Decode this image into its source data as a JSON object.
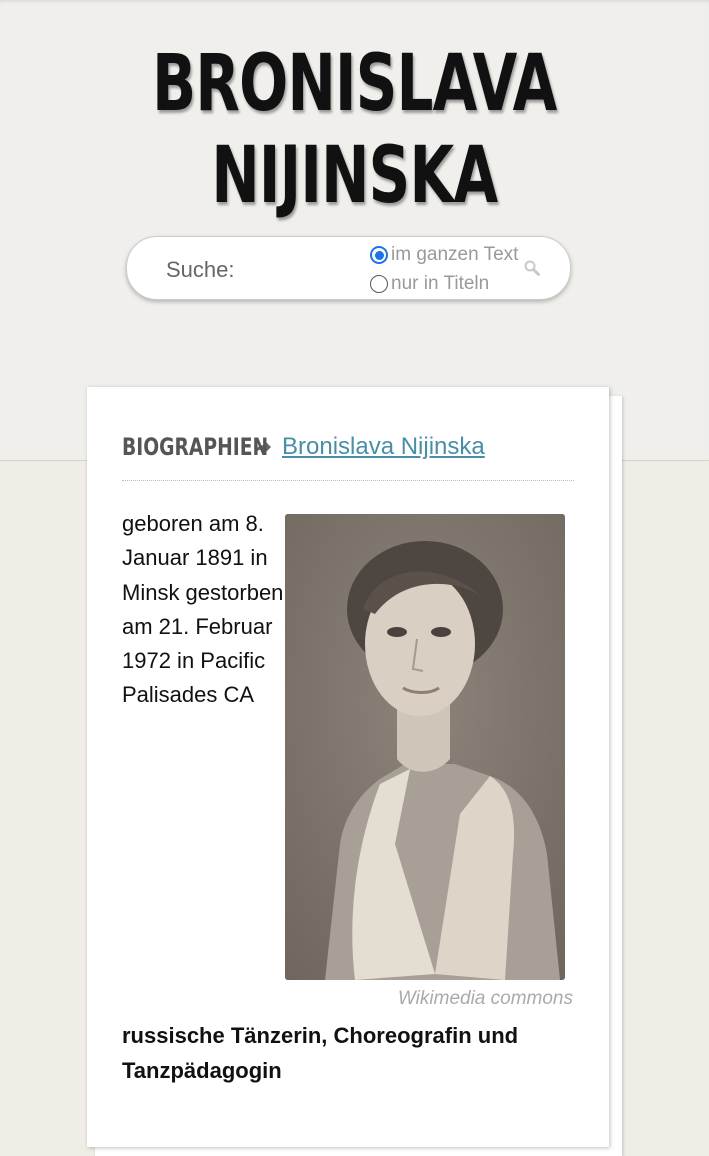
{
  "site": {
    "title_line1": "BRONISLAVA",
    "title_line2": "NIJINSKA"
  },
  "search": {
    "label": "Suche:",
    "options": [
      {
        "label": "im ganzen Text",
        "checked": true
      },
      {
        "label": "nur in Titeln",
        "checked": false
      }
    ],
    "icon": "search-icon"
  },
  "breadcrumb": {
    "section": "BIOGRAPHIEN",
    "arrow_icon": "share-arrow-icon",
    "link": "Bronislava Nijinska"
  },
  "bio": {
    "life_data": "geboren am 8. Januar 1891 in Minsk gestorben am 21. Februar 1972 in Pacific Palisades CA",
    "image_caption": "Wikimedia commons",
    "summary": "russische Tänzerin, Choreografin und Tanzpädagogin"
  },
  "colors": {
    "link": "#4a8ea6",
    "radio_accent": "#1a73e8",
    "background": "#f0ede6"
  }
}
